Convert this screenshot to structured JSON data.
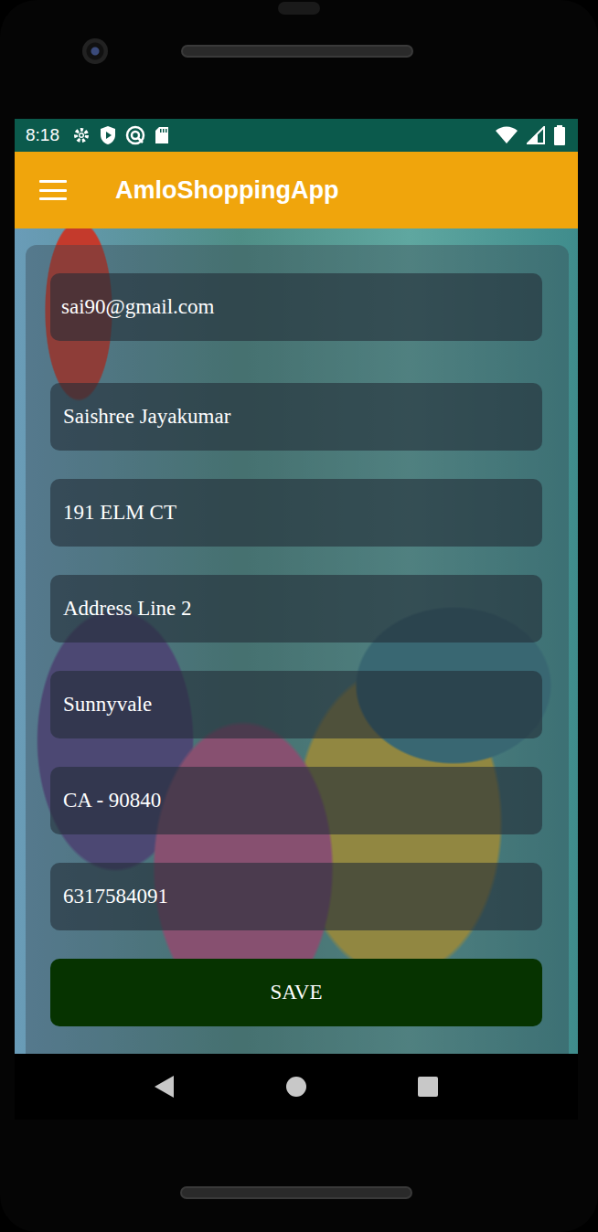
{
  "status_bar": {
    "time": "8:18"
  },
  "toolbar": {
    "title": "AmloShoppingApp"
  },
  "form": {
    "fields": [
      {
        "text": "sai90@gmail.com"
      },
      {
        "text": "Saishree Jayakumar"
      },
      {
        "text": "191 ELM CT"
      },
      {
        "text": "Address Line 2"
      },
      {
        "text": "Sunnyvale"
      },
      {
        "text": "CA - 90840"
      },
      {
        "text": "6317584091"
      }
    ],
    "button": "SAVE"
  }
}
